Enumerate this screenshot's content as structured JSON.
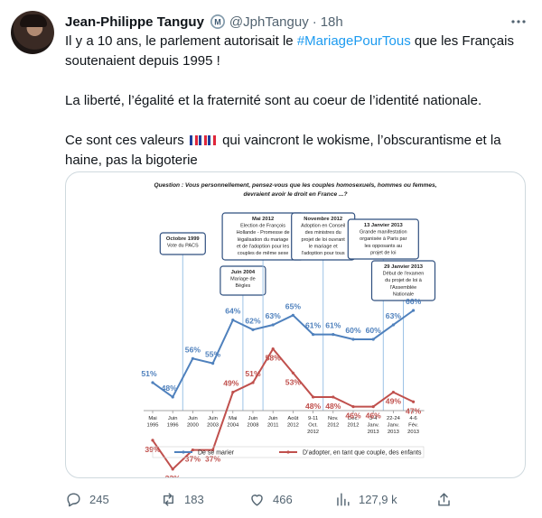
{
  "author": {
    "name": "Jean-Philippe Tanguy",
    "handle": "@JphTanguy",
    "time": "18h",
    "badge_icon": "verified-badge-icon"
  },
  "tweet": {
    "line1_before": "Il y a 10 ans, le parlement autorisait le ",
    "hashtag": "#MariagePourTous",
    "line1_after": " que les Français soutenaient depuis 1995 !",
    "para2": "La liberté, l’égalité et la fraternité sont au coeur de l’identité nationale.",
    "para3_before": "Ce sont ces valeurs ",
    "para3_after": " qui vaincront le wokisme, l’obscurantisme et la haine, pas la bigoterie"
  },
  "metrics": {
    "replies": "245",
    "retweets": "183",
    "likes": "466",
    "views": "127,9 k"
  },
  "colors": {
    "series_marriage": "#4f81bd",
    "series_adoption": "#c0504d",
    "link": "#1d9bf0"
  },
  "chart_data": {
    "type": "line",
    "title": "Question : Vous personnellement, pensez-vous que les couples homosexuels, hommes ou femmes, devraient avoir le droit en France ...?",
    "categories": [
      [
        "Mai",
        "1995"
      ],
      [
        "Juin",
        "1996"
      ],
      [
        "Juin",
        "2000"
      ],
      [
        "Juin",
        "2003"
      ],
      [
        "Mai",
        "2004"
      ],
      [
        "Juin",
        "2008"
      ],
      [
        "Juin",
        "2011"
      ],
      [
        "Août",
        "2012"
      ],
      [
        "9-11",
        "Oct.",
        "2012"
      ],
      [
        "Nov.",
        "2012"
      ],
      [
        "Déc.",
        "2012"
      ],
      [
        "3-4",
        "Janv.",
        "2013"
      ],
      [
        "22-24",
        "Janv.",
        "2013"
      ],
      [
        "4-6",
        "Fév.",
        "2013"
      ]
    ],
    "series": [
      {
        "name": "De se marier",
        "values": [
          51,
          48,
          56,
          55,
          64,
          62,
          63,
          65,
          61,
          61,
          60,
          60,
          63,
          66
        ]
      },
      {
        "name": "D’adopter, en tant que couple, des enfants",
        "values": [
          39,
          33,
          37,
          37,
          49,
          51,
          58,
          53,
          48,
          48,
          46,
          46,
          49,
          47
        ]
      }
    ],
    "ylim": [
      30,
      70
    ],
    "annotations": [
      {
        "cat": 1,
        "lines": [
          "Octobre 1999",
          "Vote du PACS"
        ]
      },
      {
        "cat": 4,
        "lines": [
          "Juin 2004",
          "Mariage de",
          "Bègles"
        ]
      },
      {
        "cat": 5,
        "lines": [
          "Mai 2012",
          "Election de François",
          "Hollande - Promesse de",
          "légalisation du mariage",
          "et de l'adoption pour les",
          "couples de même sexe"
        ]
      },
      {
        "cat": 8,
        "lines": [
          "Novembre 2012",
          "Adoption en Conseil",
          "des ministres du",
          "projet de loi ouvrant",
          "le mariage et",
          "l'adoption pour tous"
        ]
      },
      {
        "cat": 11,
        "lines": [
          "13 Janvier 2013",
          "Grande manifestation",
          "organisée à Paris par",
          "les opposants au",
          "projet de loi"
        ]
      },
      {
        "cat": 12,
        "lines": [
          "29 Janvier 2013",
          "Début de l'examen",
          "du projet de loi à",
          "l'Assemblée",
          "Nationale"
        ]
      }
    ],
    "legend_position": "bottom",
    "grid": false
  }
}
